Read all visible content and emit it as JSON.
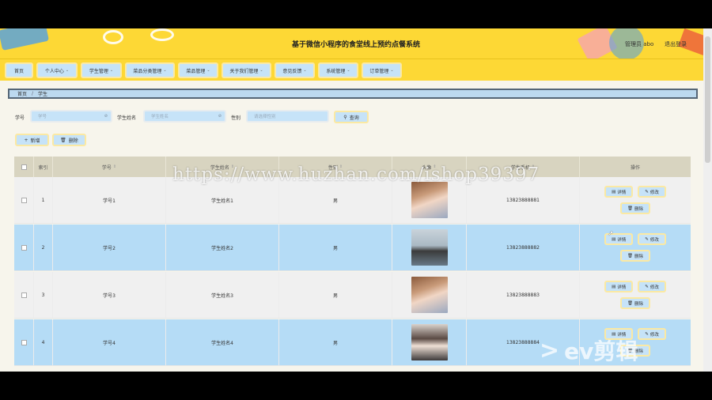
{
  "header": {
    "title": "基于微信小程序的食堂线上预约点餐系统",
    "user_role": "管理员 abo",
    "logout": "退出登录"
  },
  "nav": {
    "items": [
      {
        "label": "首页",
        "has_dropdown": false
      },
      {
        "label": "个人中心",
        "has_dropdown": true
      },
      {
        "label": "学生管理",
        "has_dropdown": true
      },
      {
        "label": "菜品分类管理",
        "has_dropdown": true
      },
      {
        "label": "菜品管理",
        "has_dropdown": true
      },
      {
        "label": "关于我们管理",
        "has_dropdown": true
      },
      {
        "label": "意见反馈",
        "has_dropdown": true
      },
      {
        "label": "系统管理",
        "has_dropdown": true
      },
      {
        "label": "订单管理",
        "has_dropdown": true
      }
    ]
  },
  "breadcrumb": {
    "home": "首页",
    "current": "学生"
  },
  "search": {
    "student_no_label": "学号",
    "student_no_placeholder": "学号",
    "student_name_label": "学生姓名",
    "student_name_placeholder": "学生姓名",
    "gender_label": "性别",
    "gender_placeholder": "请选择性别",
    "query_button": "查询"
  },
  "actions": {
    "add": "新增",
    "delete": "删除"
  },
  "table": {
    "columns": [
      "索引",
      "学号",
      "学生姓名",
      "性别",
      "头像",
      "学生手机",
      "操作"
    ],
    "rows": [
      {
        "index": "1",
        "student_no": "学号1",
        "name": "学生姓名1",
        "gender": "男",
        "phone": "13823888881"
      },
      {
        "index": "2",
        "student_no": "学号2",
        "name": "学生姓名2",
        "gender": "男",
        "phone": "13823888882"
      },
      {
        "index": "3",
        "student_no": "学号3",
        "name": "学生姓名3",
        "gender": "男",
        "phone": "13823888883"
      },
      {
        "index": "4",
        "student_no": "学号4",
        "name": "学生姓名4",
        "gender": "男",
        "phone": "13823888884"
      }
    ],
    "row_actions": {
      "detail": "详情",
      "edit": "修改",
      "delete": "删除"
    }
  },
  "overlay": {
    "watermark": "https://www.huzhan.com/ishop39397",
    "brand": "ev剪辑"
  },
  "colors": {
    "header_bg": "#fdd835",
    "button_bg": "#c6e3f8",
    "row_highlight": "#b5dcf6",
    "table_head_bg": "#d8d4c0"
  }
}
